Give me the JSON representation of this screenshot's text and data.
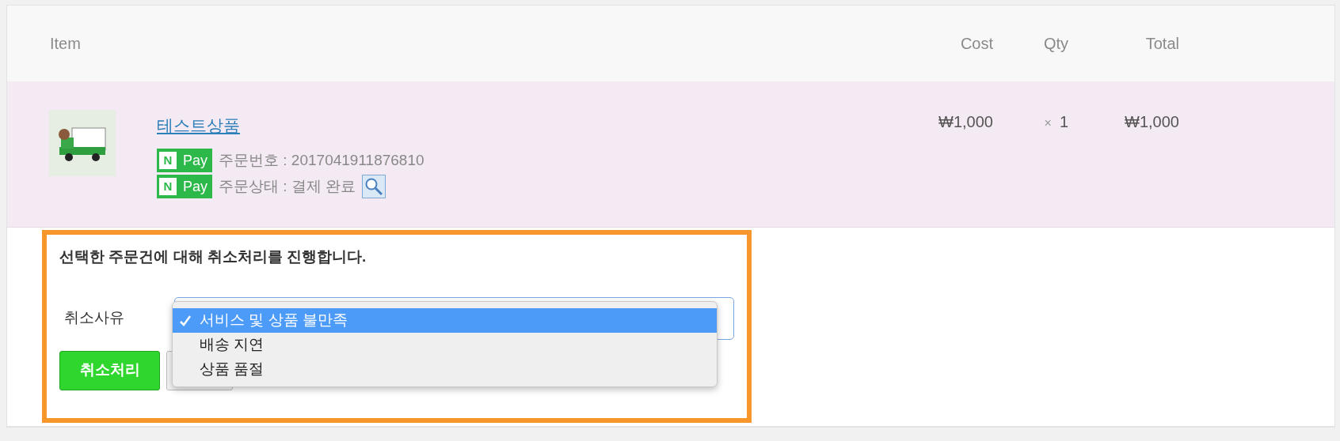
{
  "table": {
    "columns": [
      "Item",
      "Cost",
      "Qty",
      "Total"
    ],
    "rows": [
      {
        "title": "테스트상품",
        "details": [
          {
            "badge_mark": "N",
            "badge": "Pay",
            "text": "주문번호 : 2017041911876810",
            "search_icon": false
          },
          {
            "badge_mark": "N",
            "badge": "Pay",
            "text": "주문상태 : 결제 완료",
            "search_icon": true
          }
        ],
        "cost": "₩1,000",
        "qty_sign": "×",
        "qty": "1",
        "total": "₩1,000"
      }
    ]
  },
  "cancel_panel": {
    "message": "선택한 주문건에 대해 취소처리를 진행합니다.",
    "reason_label": "취소사유",
    "reason_options": [
      {
        "label": "서비스 및 상품 불만족",
        "selected": true
      },
      {
        "label": "배송 지연",
        "selected": false
      },
      {
        "label": "상품 품절",
        "selected": false
      }
    ],
    "buttons": [
      {
        "kind": "primary",
        "label": "취소처리"
      },
      {
        "kind": "secondary"
      }
    ]
  }
}
